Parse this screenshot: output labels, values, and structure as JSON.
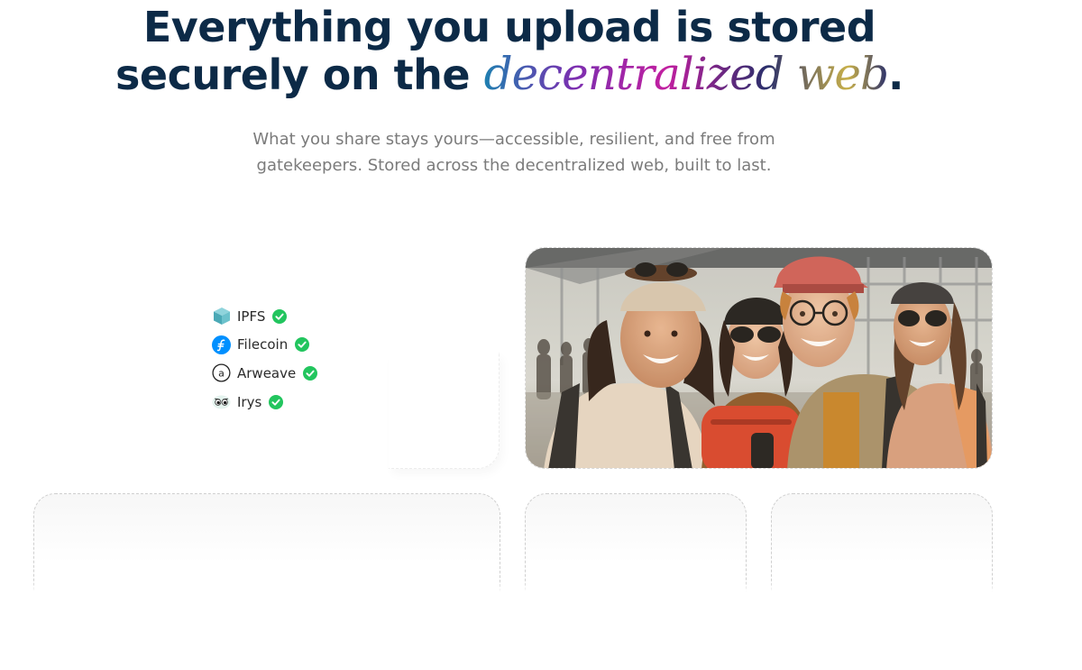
{
  "hero": {
    "headline_line1": "Everything you upload is stored",
    "headline_line2_prefix": "securely on the ",
    "headline_fancy": "decentralized web",
    "headline_period": ".",
    "subtitle_line1": "What you share stays yours—accessible, resilient, and free from",
    "subtitle_line2": "gatekeepers. Stored across the decentralized web, built to last."
  },
  "storage": {
    "items": [
      {
        "label": "IPFS",
        "icon": "ipfs-cube-icon",
        "status": "check-icon"
      },
      {
        "label": "Filecoin",
        "icon": "filecoin-icon",
        "status": "check-icon"
      },
      {
        "label": "Arweave",
        "icon": "arweave-icon",
        "status": "check-icon"
      },
      {
        "label": "Irys",
        "icon": "irys-eyes-icon",
        "status": "check-icon"
      }
    ]
  },
  "colors": {
    "headline": "#0c2a47",
    "subtitle": "#7b7b7b",
    "check_green": "#22c55e",
    "ipfs_teal": "#5fb5c0",
    "filecoin_blue": "#0090ff"
  }
}
